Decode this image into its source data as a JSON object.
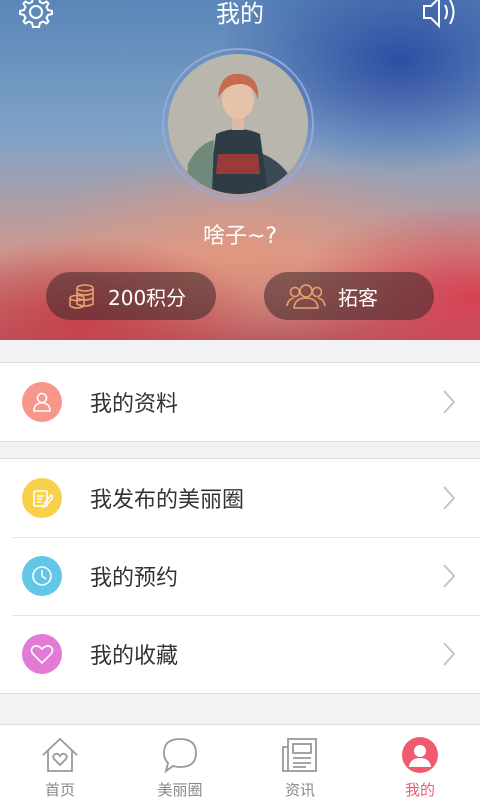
{
  "header": {
    "title": "我的",
    "settings_icon": "gear-icon",
    "sound_icon": "speaker-icon"
  },
  "profile": {
    "username": "啥子~?",
    "points_label": "200积分",
    "expand_label": "拓客"
  },
  "menu": {
    "groups": [
      [
        {
          "label": "我的资料",
          "icon": "user-icon",
          "color": "#f7968a"
        }
      ],
      [
        {
          "label": "我发布的美丽圈",
          "icon": "edit-icon",
          "color": "#f8d04a"
        },
        {
          "label": "我的预约",
          "icon": "clock-icon",
          "color": "#62c6e6"
        },
        {
          "label": "我的收藏",
          "icon": "heart-icon",
          "color": "#e27ad6"
        }
      ]
    ]
  },
  "tabbar": {
    "items": [
      {
        "label": "首页",
        "icon": "home-icon",
        "active": false
      },
      {
        "label": "美丽圈",
        "icon": "chat-bubble-icon",
        "active": false
      },
      {
        "label": "资讯",
        "icon": "news-icon",
        "active": false
      },
      {
        "label": "我的",
        "icon": "profile-icon",
        "active": true
      }
    ],
    "active_color": "#f05a6e"
  }
}
